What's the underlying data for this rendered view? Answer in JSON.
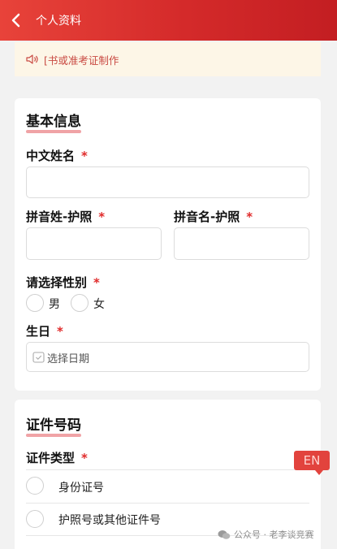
{
  "header": {
    "title": "个人资料",
    "back_icon": "chevron-left-icon"
  },
  "notice": {
    "icon": "speaker-icon",
    "text": "[书或准考证制作"
  },
  "basic_info": {
    "title": "基本信息",
    "chinese_name": {
      "label": "中文姓名",
      "required": "*",
      "value": ""
    },
    "pinyin_surname": {
      "label": "拼音姓-护照",
      "required": "*",
      "value": ""
    },
    "pinyin_given": {
      "label": "拼音名-护照",
      "required": "*",
      "value": ""
    },
    "gender": {
      "label": "请选择性别",
      "required": "*",
      "options": [
        "男",
        "女"
      ]
    },
    "birthday": {
      "label": "生日",
      "required": "*",
      "placeholder": "选择日期",
      "icon": "calendar-icon"
    }
  },
  "id_section": {
    "title": "证件号码",
    "type": {
      "label": "证件类型",
      "required": "*",
      "options": [
        "身份证号",
        "护照号或其他证件号"
      ]
    }
  },
  "lang_badge": "EN",
  "watermark": "公众号 · 老李谈竞赛",
  "colors": {
    "primary": "#d42a2a",
    "required": "#e02a2a",
    "notice_bg": "#fdf6e7"
  }
}
